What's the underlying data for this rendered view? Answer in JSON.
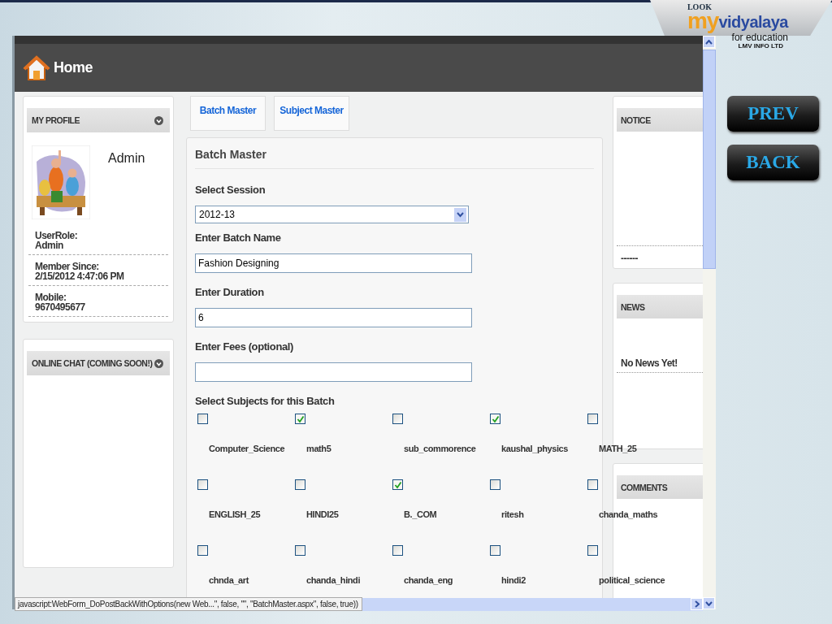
{
  "logo": {
    "top": "LOOK",
    "name_1": "my",
    "name_2": "vidyalaya",
    "tagline": "for education",
    "company": "LMV INFO LTD"
  },
  "nav_buttons": [
    "PREV",
    "BACK"
  ],
  "header": {
    "title": "Home"
  },
  "profile": {
    "title": "MY PROFILE",
    "name": "Admin",
    "fields": [
      {
        "label": "UserRole:",
        "value": "Admin"
      },
      {
        "label": "Member Since:",
        "value": "2/15/2012 4:47:06 PM"
      },
      {
        "label": "Mobile:",
        "value": "9670495677"
      }
    ]
  },
  "chat": {
    "title": "ONLINE CHAT (COMING SOON!)"
  },
  "tabs": [
    {
      "label": "Batch Master"
    },
    {
      "label": "Subject Master"
    }
  ],
  "form": {
    "title": "Batch Master",
    "session_label": "Select Session",
    "session_value": "2012-13",
    "batch_label": "Enter Batch Name",
    "batch_value": "Fashion Designing",
    "duration_label": "Enter Duration",
    "duration_value": "6",
    "fees_label": "Enter Fees (optional)",
    "subjects_label": "Select Subjects for this Batch",
    "subjects": [
      {
        "label": "Computer_Science",
        "checked": false
      },
      {
        "label": "math5",
        "checked": true
      },
      {
        "label": "sub_commorence",
        "checked": false
      },
      {
        "label": "kaushal_physics",
        "checked": true
      },
      {
        "label": "MATH_25",
        "checked": false
      },
      {
        "label": "ENGLISH_25",
        "checked": false
      },
      {
        "label": "HINDI25",
        "checked": false
      },
      {
        "label": "B._COM",
        "checked": true
      },
      {
        "label": "ritesh",
        "checked": false
      },
      {
        "label": "chanda_maths",
        "checked": false
      },
      {
        "label": "chnda_art",
        "checked": false
      },
      {
        "label": "chanda_hindi",
        "checked": false
      },
      {
        "label": "chanda_eng",
        "checked": false
      },
      {
        "label": "hindi2",
        "checked": false
      },
      {
        "label": "political_science",
        "checked": false
      }
    ]
  },
  "notice": {
    "title": "NOTICE",
    "text": "------"
  },
  "news": {
    "title": "NEWS",
    "text": "No News Yet!"
  },
  "comments": {
    "title": "COMMENTS"
  },
  "status_bar": {
    "text": "javascript:WebForm_DoPostBackWithOptions(new Web...\", false, \"\", \"BatchMaster.aspx\", false, true))"
  }
}
